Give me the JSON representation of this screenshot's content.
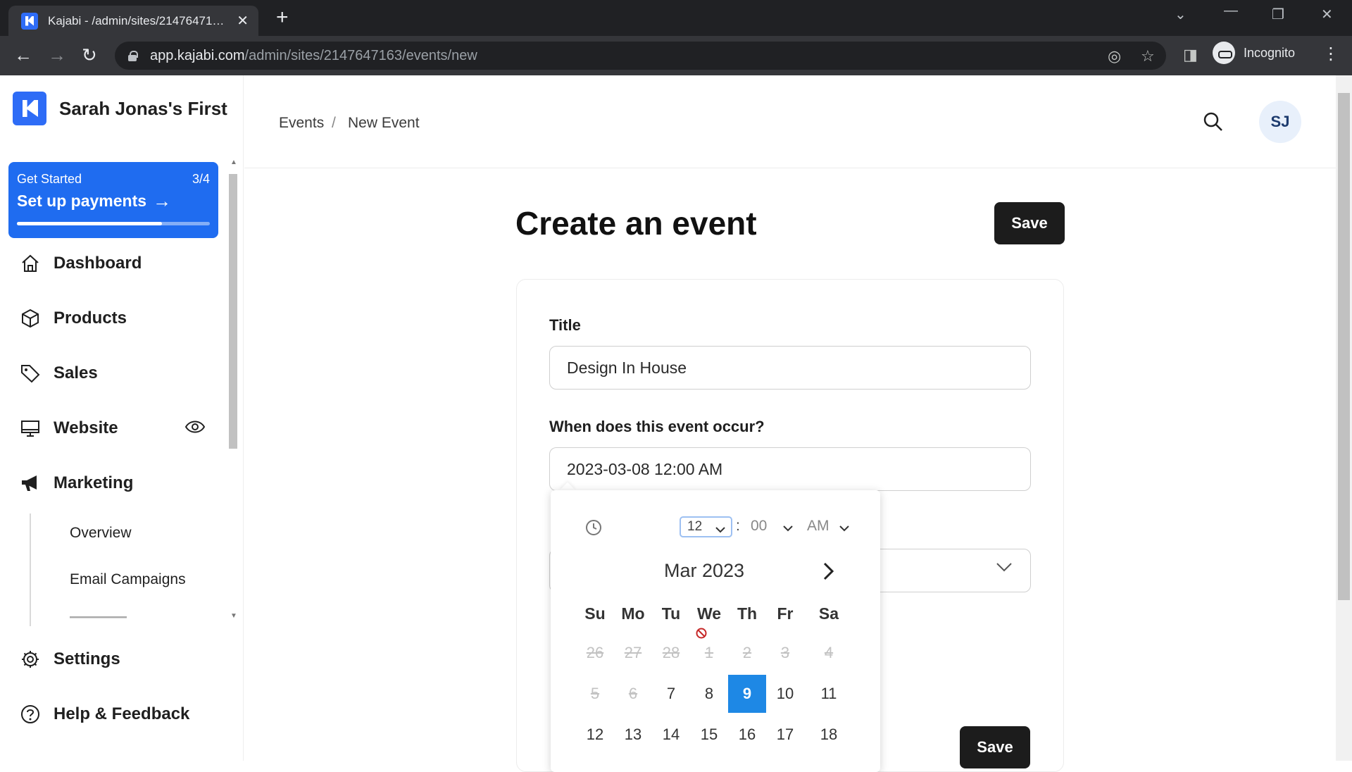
{
  "browser": {
    "tab_title": "Kajabi - /admin/sites/21476471…",
    "url_host": "app.kajabi.com",
    "url_path": "/admin/sites/2147647163/events/new",
    "profile_label": "Incognito"
  },
  "sidebar": {
    "site_name": "Sarah Jonas's First",
    "get_started": {
      "label": "Get Started",
      "count": "3/4",
      "title": "Set up payments",
      "progress": 0.75
    },
    "items": [
      {
        "label": "Dashboard"
      },
      {
        "label": "Products"
      },
      {
        "label": "Sales"
      },
      {
        "label": "Website"
      },
      {
        "label": "Marketing"
      }
    ],
    "sub_items": [
      {
        "label": "Overview"
      },
      {
        "label": "Email Campaigns"
      }
    ],
    "bottom_items": [
      {
        "label": "Settings"
      },
      {
        "label": "Help & Feedback"
      }
    ]
  },
  "header": {
    "breadcrumb": [
      "Events",
      "/",
      "New Event"
    ],
    "avatar_initials": "SJ"
  },
  "page": {
    "title": "Create an event",
    "save_label": "Save",
    "form": {
      "title_label": "Title",
      "title_value": "Design In House",
      "when_label": "When does this event occur?",
      "when_value": "2023-03-08 12:00 AM"
    }
  },
  "datepicker": {
    "hour": "12",
    "minute": "00",
    "ampm": "AM",
    "month_label": "Mar 2023",
    "weekdays": [
      "Su",
      "Mo",
      "Tu",
      "We",
      "Th",
      "Fr",
      "Sa"
    ],
    "weeks": [
      [
        {
          "d": "26",
          "dis": true
        },
        {
          "d": "27",
          "dis": true
        },
        {
          "d": "28",
          "dis": true
        },
        {
          "d": "1",
          "dis": true
        },
        {
          "d": "2",
          "dis": true
        },
        {
          "d": "3",
          "dis": true
        },
        {
          "d": "4",
          "dis": true
        }
      ],
      [
        {
          "d": "5",
          "dis": true
        },
        {
          "d": "6",
          "dis": true
        },
        {
          "d": "7"
        },
        {
          "d": "8"
        },
        {
          "d": "9",
          "sel": true
        },
        {
          "d": "10"
        },
        {
          "d": "11"
        }
      ],
      [
        {
          "d": "12"
        },
        {
          "d": "13"
        },
        {
          "d": "14"
        },
        {
          "d": "15"
        },
        {
          "d": "16"
        },
        {
          "d": "17"
        },
        {
          "d": "18"
        }
      ]
    ]
  },
  "colors": {
    "brand": "#2e6cf6",
    "get_started_bg": "#1f6cf0",
    "selected_day": "#1e88e5",
    "button_dark": "#1c1c1c"
  }
}
